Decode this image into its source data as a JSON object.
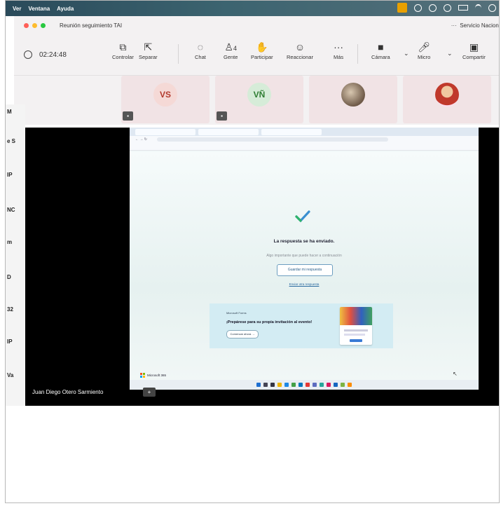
{
  "menubar": {
    "items": [
      "Ver",
      "Ventana",
      "Ayuda"
    ],
    "colors": {
      "recording": "#e8a000"
    }
  },
  "window": {
    "title": "Reunión seguimiento TAI",
    "org_label": "Servicio Nacional",
    "more_label": "···"
  },
  "toolbar": {
    "timer": "02:24:48",
    "tools": [
      {
        "label": "Controlar",
        "icon": "cast-icon"
      },
      {
        "label": "Separar",
        "icon": "popout-icon"
      },
      {
        "label": "Chat",
        "icon": "chat-icon"
      },
      {
        "label": "Gente",
        "icon": "people-icon",
        "badge": "4"
      },
      {
        "label": "Participar",
        "icon": "hand-icon"
      },
      {
        "label": "Reaccionar",
        "icon": "emoji-icon"
      },
      {
        "label": "Más",
        "icon": "more-icon"
      },
      {
        "label": "Cámara",
        "icon": "camera-off-icon"
      },
      {
        "label": "Micro",
        "icon": "mic-icon"
      },
      {
        "label": "Compartir",
        "icon": "share-icon"
      }
    ]
  },
  "participants": [
    {
      "initials": "VS",
      "color": "#b23a2e",
      "bg": "#f5d9d6"
    },
    {
      "initials": "VÑ",
      "color": "#2e7d32",
      "bg": "#d6ecd8"
    },
    {
      "initials": "",
      "type": "photo"
    },
    {
      "initials": "",
      "type": "photo"
    }
  ],
  "left_panel": [
    "M",
    "e S",
    "IP",
    "NC",
    "m",
    "D",
    "32",
    "IP",
    "Va"
  ],
  "shared": {
    "presenter": "Juan Diego Otero Sarmiento",
    "form": {
      "title": "La respuesta se ha enviado.",
      "subtitle": "Algo importante que puede hacer a continuación",
      "save_button": "Guardar mi respuesta",
      "send_link": "Enviar otra respuesta",
      "promo_brand": "Microsoft Forms",
      "promo_title": "¡Prepárese para su propia invitación al evento!",
      "promo_button": "Comenzar ahora →",
      "footer_brand": "Microsoft 365"
    }
  }
}
